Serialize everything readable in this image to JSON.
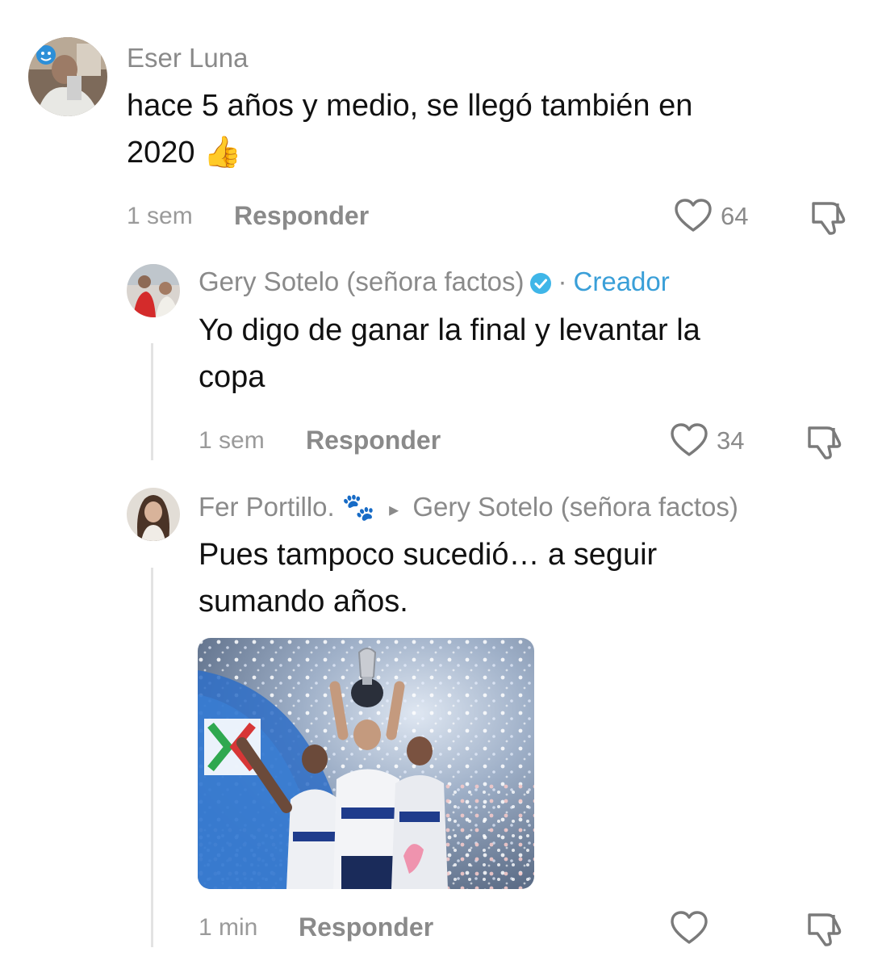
{
  "comments": [
    {
      "username": "Eser Luna",
      "text_lines": [
        "hace 5 años y medio, se llegó también en",
        "2020 👍"
      ],
      "time": "1 sem",
      "reply_label": "Responder",
      "likes": "64"
    },
    {
      "username": "Gery Sotelo (señora factos)",
      "separator": "·",
      "badge_label": "Creador",
      "text_lines": [
        "Yo digo de ganar la final y levantar la",
        "copa"
      ],
      "time": "1 sem",
      "reply_label": "Responder",
      "likes": "34"
    },
    {
      "username": "Fer Portillo. 🐾",
      "reply_to_arrow": "▸",
      "reply_to": "Gery Sotelo (señora factos)",
      "text_lines": [
        "Pues tampoco sucedió… a seguir",
        "sumando años."
      ],
      "time": "1 min",
      "reply_label": "Responder",
      "likes": ""
    }
  ],
  "icons": {
    "like": "heart-outline-icon",
    "dislike": "thumbs-down-icon",
    "verified": "verified-badge-icon"
  },
  "colors": {
    "creator": "#3a9fd8",
    "muted": "#8a8a8a",
    "text": "#111111"
  }
}
